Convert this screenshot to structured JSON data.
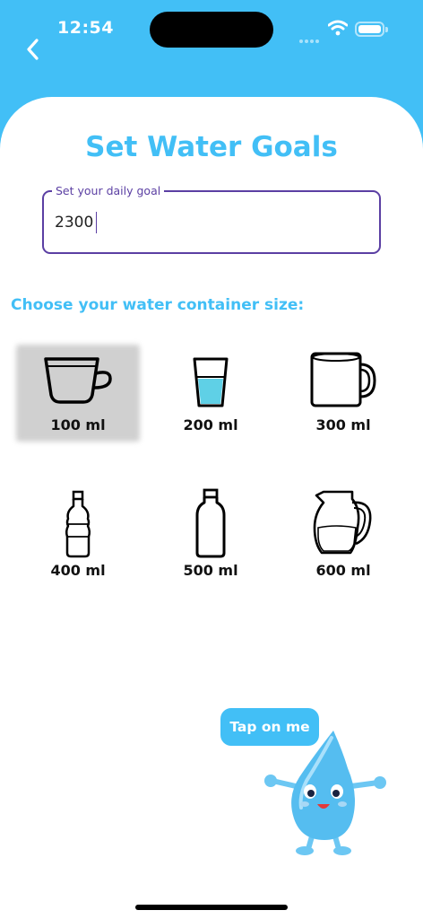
{
  "status_bar": {
    "time": "12:54"
  },
  "header": {
    "title": "Set Water Goals"
  },
  "goal": {
    "label": "Set your daily goal",
    "value": "2300"
  },
  "containers": {
    "heading": "Choose your water container size:",
    "options": [
      {
        "label": "100 ml",
        "icon": "cup-icon",
        "selected": true
      },
      {
        "label": "200 ml",
        "icon": "glass-icon",
        "selected": false
      },
      {
        "label": "300 ml",
        "icon": "mug-icon",
        "selected": false
      },
      {
        "label": "400 ml",
        "icon": "small-bottle-icon",
        "selected": false
      },
      {
        "label": "500 ml",
        "icon": "bottle-icon",
        "selected": false
      },
      {
        "label": "600 ml",
        "icon": "pitcher-icon",
        "selected": false
      }
    ]
  },
  "mascot": {
    "bubble_text": "Tap on me"
  },
  "colors": {
    "accent": "#42bff6",
    "field_border": "#5b3fa3",
    "selected_bg": "#d0d0d0"
  }
}
